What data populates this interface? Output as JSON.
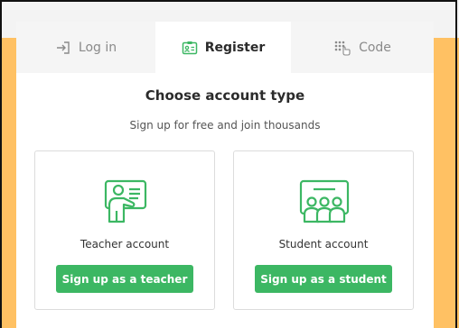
{
  "tabs": {
    "login": {
      "label": "Log in",
      "icon": "login-arrow-icon"
    },
    "register": {
      "label": "Register",
      "icon": "id-card-icon",
      "active": true
    },
    "code": {
      "label": "Code",
      "icon": "keypad-pointer-icon"
    }
  },
  "main": {
    "title": "Choose account type",
    "subtitle": "Sign up for free and join thousands"
  },
  "options": [
    {
      "label": "Teacher account",
      "button": "Sign up as a teacher",
      "icon": "teacher-board-icon"
    },
    {
      "label": "Student account",
      "button": "Sign up as a student",
      "icon": "students-class-icon"
    }
  ],
  "colors": {
    "accent_green": "#3cb763",
    "side_band": "#ffc163"
  }
}
